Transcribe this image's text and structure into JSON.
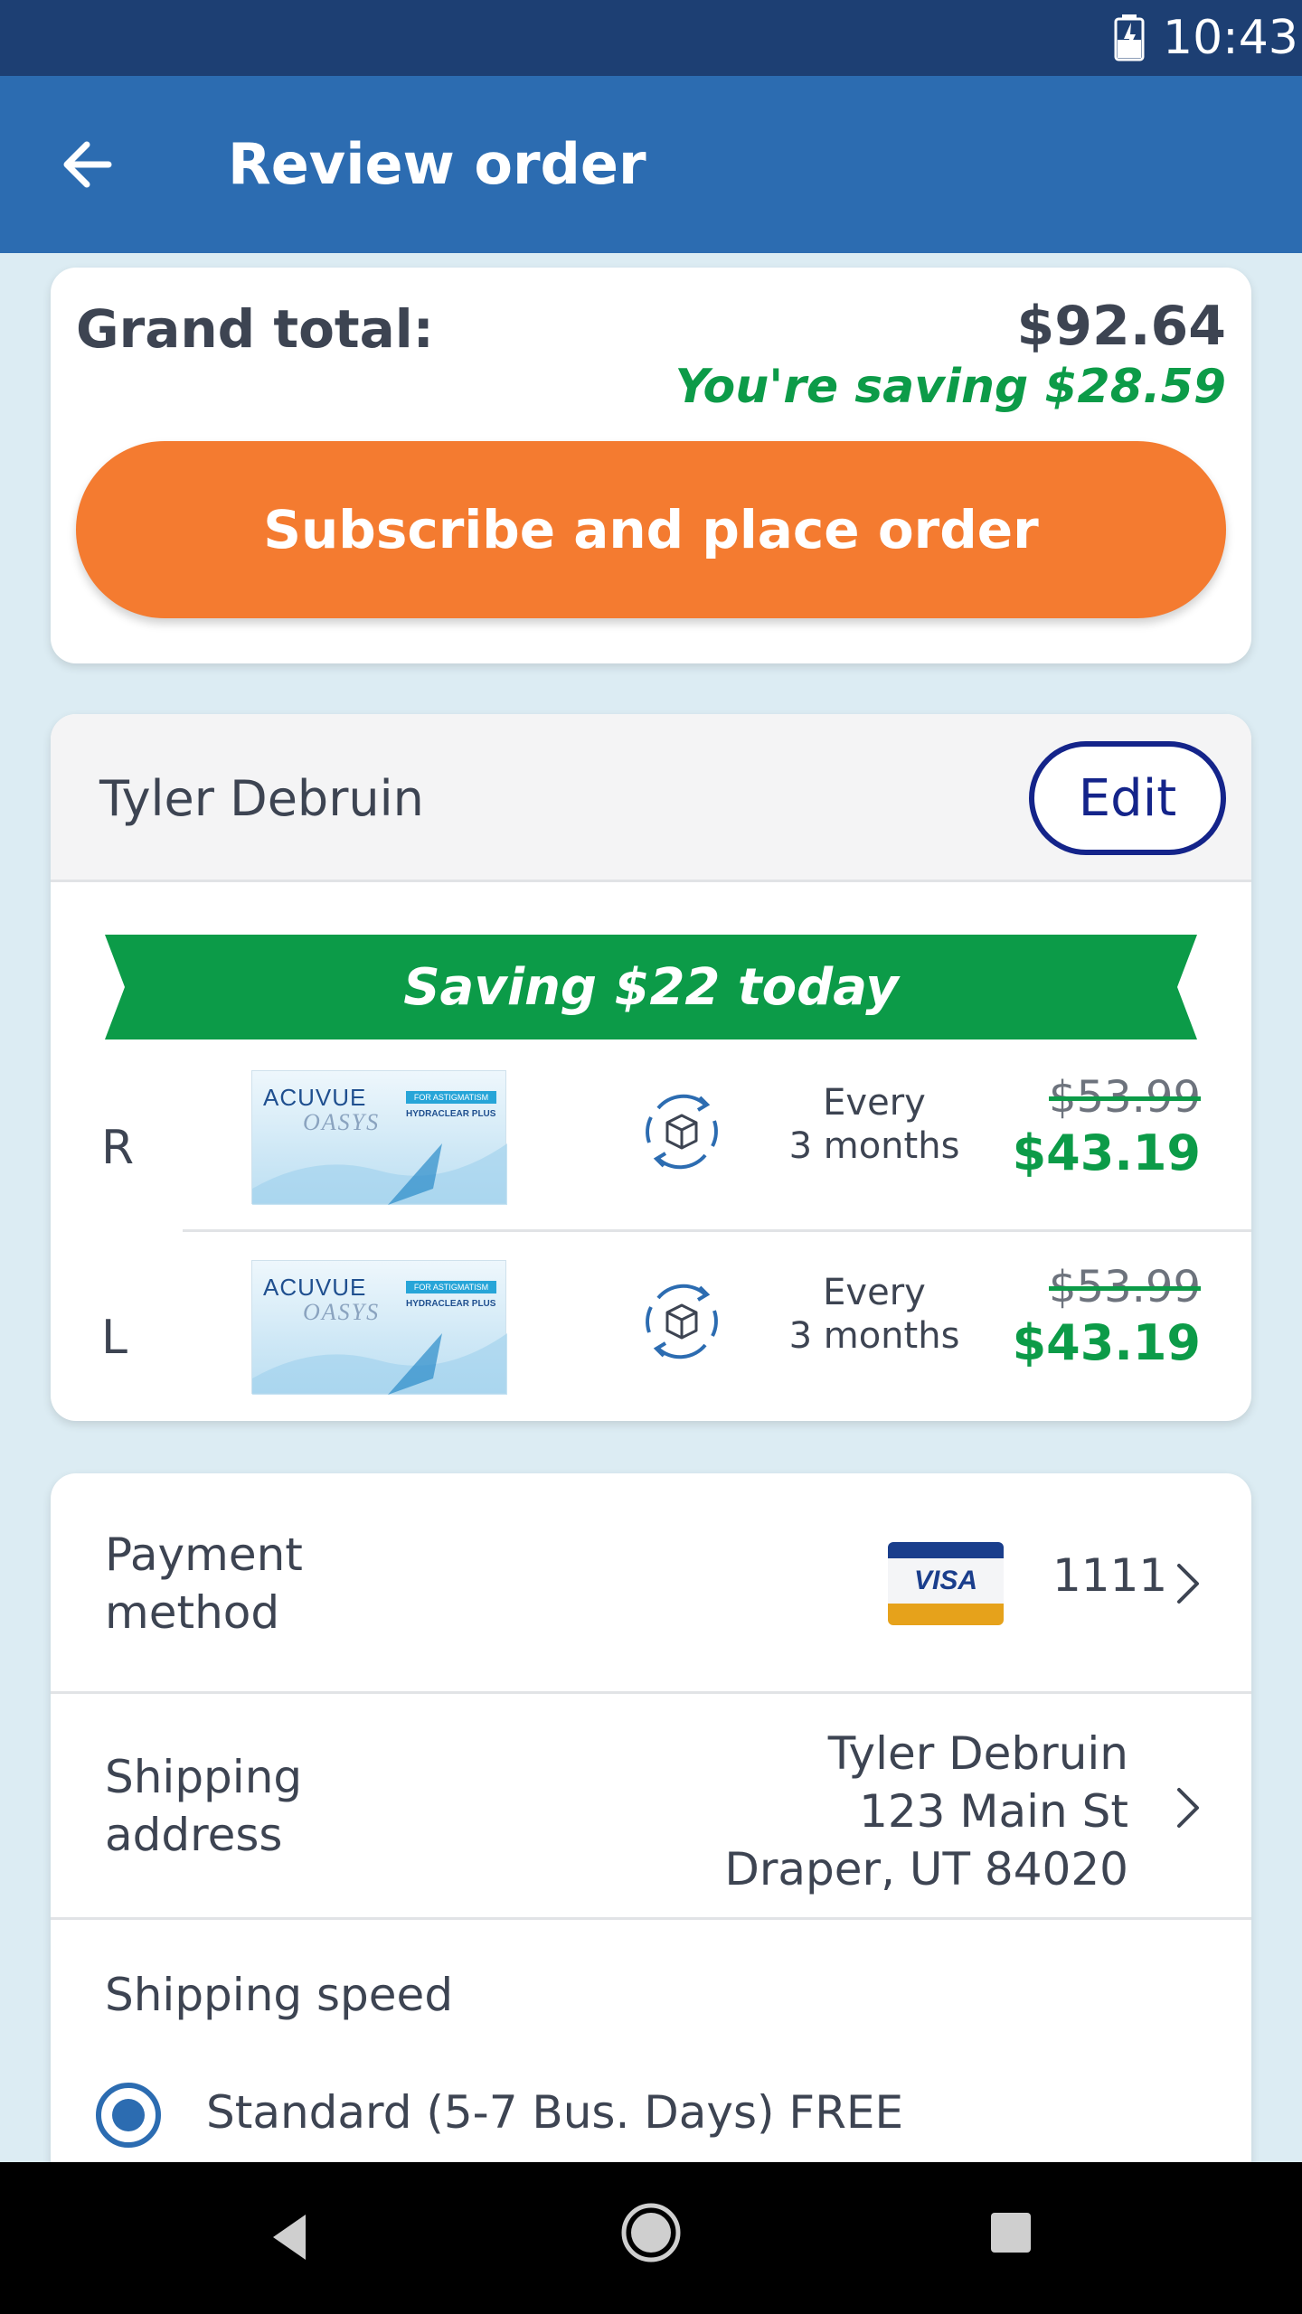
{
  "status_bar": {
    "time": "10:43",
    "battery_icon": "battery-charging-icon"
  },
  "app_bar": {
    "title": "Review order",
    "back_icon": "arrow-left-icon"
  },
  "summary": {
    "grand_total_label": "Grand total:",
    "grand_total": "$92.64",
    "saving_text": "You're saving $28.59",
    "cta_label": "Subscribe and place order",
    "cta_color": "#f47b30"
  },
  "order": {
    "patient_name": "Tyler Debruin",
    "edit_label": "Edit",
    "banner_text": "Saving $22 today",
    "banner_color": "#0c9b48",
    "items": [
      {
        "eye": "R",
        "product_brand": "ACUVUE",
        "product_line": "OASYS",
        "product_tag": "FOR ASTIGMATISM",
        "product_sub": "HYDRACLEAR PLUS",
        "frequency_line1": "Every",
        "frequency_line2": "3 months",
        "old_price": "$53.99",
        "new_price": "$43.19"
      },
      {
        "eye": "L",
        "product_brand": "ACUVUE",
        "product_line": "OASYS",
        "product_tag": "FOR ASTIGMATISM",
        "product_sub": "HYDRACLEAR PLUS",
        "frequency_line1": "Every",
        "frequency_line2": "3 months",
        "old_price": "$53.99",
        "new_price": "$43.19"
      }
    ]
  },
  "payment": {
    "label_line1": "Payment",
    "label_line2": "method",
    "card_brand": "VISA",
    "last4": "1111"
  },
  "shipping": {
    "label_line1": "Shipping",
    "label_line2": "address",
    "name": "Tyler Debruin",
    "street": "123 Main St",
    "city": "Draper, UT 84020"
  },
  "shipping_speed": {
    "label": "Shipping speed",
    "selected_option": "Standard (5-7 Bus. Days) FREE"
  },
  "colors": {
    "app_bar": "#2c6cb1",
    "status_bar": "#1d3f73",
    "saving_green": "#0c9b48",
    "edit_border": "#14248a"
  }
}
